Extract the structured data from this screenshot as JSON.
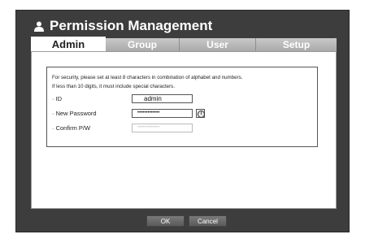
{
  "window": {
    "title": "Permission Management",
    "title_icon": "user-icon"
  },
  "tabs": [
    {
      "label": "Admin",
      "active": true
    },
    {
      "label": "Group",
      "active": false
    },
    {
      "label": "User",
      "active": false
    },
    {
      "label": "Setup",
      "active": false
    }
  ],
  "form": {
    "note_line1": "For security, please set at least 8 characters in combination of alphabet and numbers.",
    "note_line2": "If less than 10 digits, it must include special characters.",
    "id_label": "· ID",
    "id_value": "admin",
    "new_password_label": "· New Password",
    "new_password_value": "•••••••••••••",
    "info_icon": "info-icon",
    "confirm_label": "· Confirm P/W",
    "confirm_value": "•••••••••••••"
  },
  "buttons": {
    "ok_label": "OK",
    "cancel_label": "Cancel"
  }
}
